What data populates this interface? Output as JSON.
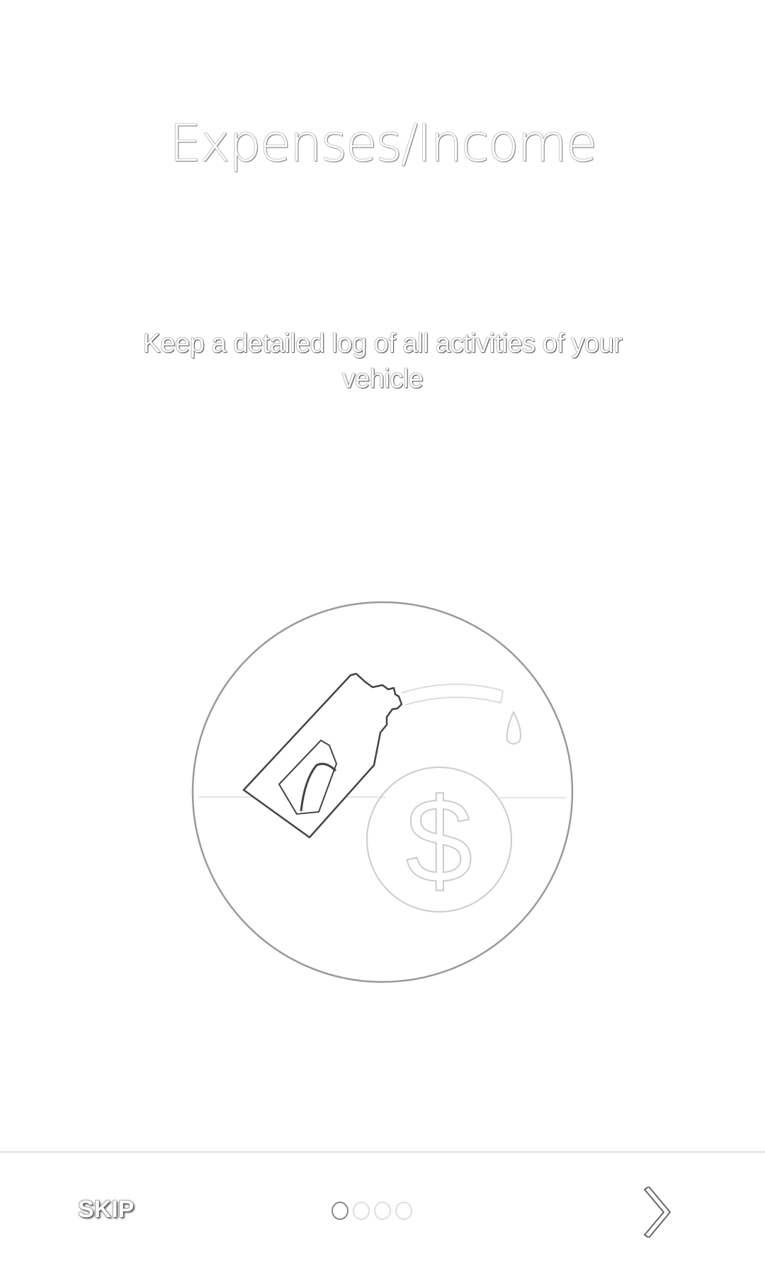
{
  "intro": {
    "title": "Expenses/Income",
    "description": "Keep a detailed log of all activities of your vehicle"
  },
  "footer": {
    "skip_label": "SKIP",
    "page_count": 4,
    "current_page": 1,
    "next_icon": "chevron-right-icon"
  },
  "illustration": {
    "icons": [
      "fuel-nozzle-icon",
      "dollar-coin-icon"
    ]
  }
}
